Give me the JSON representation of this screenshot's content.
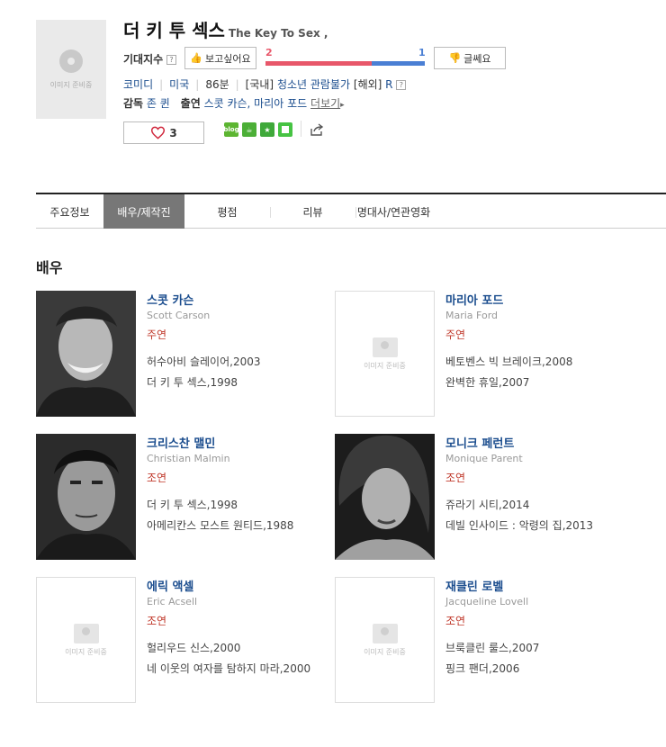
{
  "movie": {
    "title_ko": "더 키 투 섹스",
    "title_en": "The Key To Sex ,",
    "poster_caption": "이미지 준비중"
  },
  "expect": {
    "label": "기대지수",
    "help": "?",
    "want_label": "보고싶어요",
    "want_count": "2",
    "nowant_count": "1",
    "nowant_label": "글쎄요",
    "want_color": "#e8576a",
    "nowant_color": "#4a7fd4"
  },
  "info": {
    "genre": "코미디",
    "country": "미국",
    "runtime": "86분",
    "rating_domestic_tag": "[국내]",
    "rating_domestic": "청소년 관람불가",
    "rating_foreign_tag": "[해외]",
    "rating_foreign": "R",
    "help": "?"
  },
  "credits": {
    "director_label": "감독",
    "director": "존 퀸",
    "cast_label": "출연",
    "cast": "스콧 카슨, 마리아 포드",
    "more": "더보기",
    "more_icon": "▸"
  },
  "like": {
    "count": "3"
  },
  "share": {
    "blog_label": "blog"
  },
  "tabs": [
    {
      "label": "주요정보"
    },
    {
      "label": "배우/제작진"
    },
    {
      "label": "평점"
    },
    {
      "label": "리뷰"
    },
    {
      "label": "명대사/연관영화"
    }
  ],
  "section": {
    "title": "배우"
  },
  "actors": [
    {
      "kname": "스콧 카슨",
      "ename": "Scott Carson",
      "role": "주연",
      "work1": "허수아비 슬레이어,2003",
      "work2": "더 키 투 섹스,1998"
    },
    {
      "kname": "마리아 포드",
      "ename": "Maria Ford",
      "role": "주연",
      "work1": "베토벤스 빅 브레이크,2008",
      "work2": "완벽한 휴일,2007",
      "caption": "이미지 준비중"
    },
    {
      "kname": "크리스찬 맬민",
      "ename": "Christian Malmin",
      "role": "조연",
      "work1": "더 키 투 섹스,1998",
      "work2": "아메리칸스 모스트 원티드,1988"
    },
    {
      "kname": "모니크 페런트",
      "ename": "Monique Parent",
      "role": "조연",
      "work1": "쥬라기 시티,2014",
      "work2": "데빌 인사이드 : 악령의 집,2013"
    },
    {
      "kname": "에릭 액셀",
      "ename": "Eric Acsell",
      "role": "조연",
      "work1": "헐리우드 신스,2000",
      "work2": "네 이웃의 여자를 탐하지 마라,2000",
      "caption": "이미지 준비중"
    },
    {
      "kname": "재클린 로벨",
      "ename": "Jacqueline Lovell",
      "role": "조연",
      "work1": "브룩클린 룰스,2007",
      "work2": "핑크 팬더,2006",
      "caption": "이미지 준비중"
    }
  ]
}
